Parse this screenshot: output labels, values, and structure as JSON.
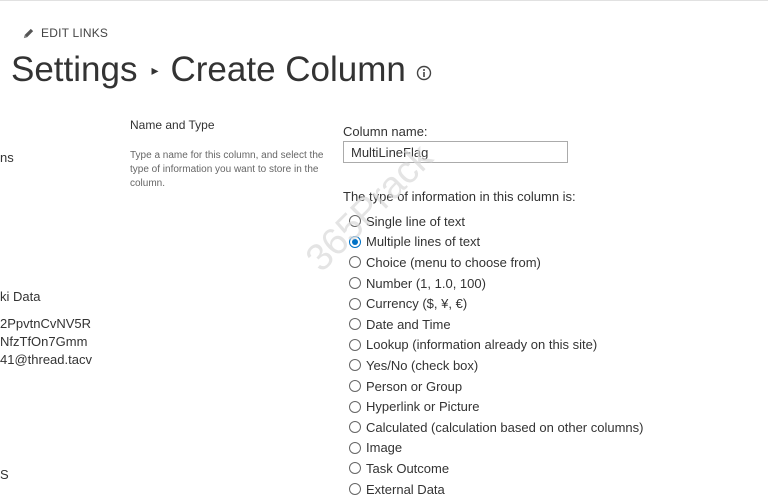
{
  "header": {
    "edit_links": "EDIT LINKS",
    "title_part1": "Settings",
    "title_separator": "▸",
    "title_part2": "Create Column"
  },
  "left_nav": {
    "item1": "ns",
    "item2": "ki Data",
    "item3": "2PpvtnCvNV5R",
    "item4": "NfzTfOn7Gmm",
    "item5": "41@thread.tacv",
    "item6": "S"
  },
  "section": {
    "title": "Name and Type",
    "description": "Type a name for this column, and select the type of information you want to store in the column."
  },
  "form": {
    "column_name_label": "Column name:",
    "column_name_value": "MultiLineFlag",
    "type_label": "The type of information in this column is:",
    "options": [
      {
        "label": "Single line of text",
        "checked": false
      },
      {
        "label": "Multiple lines of text",
        "checked": true
      },
      {
        "label": "Choice (menu to choose from)",
        "checked": false
      },
      {
        "label": "Number (1, 1.0, 100)",
        "checked": false
      },
      {
        "label": "Currency ($, ¥, €)",
        "checked": false
      },
      {
        "label": "Date and Time",
        "checked": false
      },
      {
        "label": "Lookup (information already on this site)",
        "checked": false
      },
      {
        "label": "Yes/No (check box)",
        "checked": false
      },
      {
        "label": "Person or Group",
        "checked": false
      },
      {
        "label": "Hyperlink or Picture",
        "checked": false
      },
      {
        "label": "Calculated (calculation based on other columns)",
        "checked": false
      },
      {
        "label": "Image",
        "checked": false
      },
      {
        "label": "Task Outcome",
        "checked": false
      },
      {
        "label": "External Data",
        "checked": false
      }
    ]
  },
  "watermark": "365Prack",
  "colors": {
    "accent": "#0072c6",
    "text": "#333333"
  }
}
